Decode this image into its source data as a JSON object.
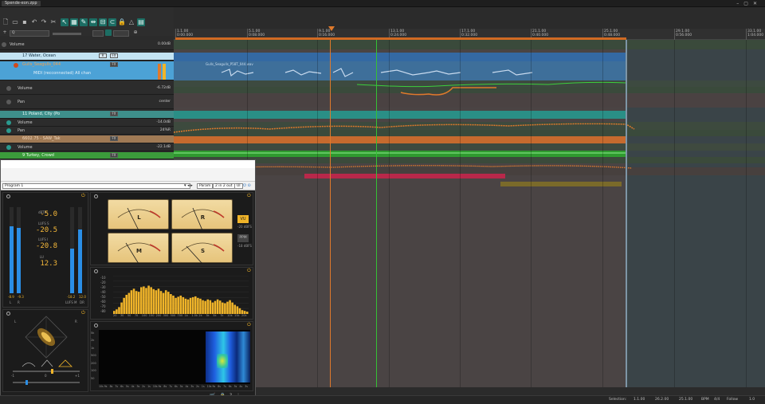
{
  "window": {
    "tab_title": "Spende-eon.zpp"
  },
  "ruler": {
    "marks": [
      {
        "bar": "1.1.00",
        "time": "0:00.000"
      },
      {
        "bar": "5.1.00",
        "time": "0:08.000"
      },
      {
        "bar": "9.1.00",
        "time": "0:16.000"
      },
      {
        "bar": "13.1.00",
        "time": "0:24.000"
      },
      {
        "bar": "17.1.00",
        "time": "0:32.000"
      },
      {
        "bar": "21.1.00",
        "time": "0:40.000"
      },
      {
        "bar": "25.1.00",
        "time": "0:48.000"
      },
      {
        "bar": "29.1.00",
        "time": "0:56.000"
      },
      {
        "bar": "33.1.00",
        "time": "1:04.000"
      }
    ]
  },
  "tracks": {
    "master_volume": {
      "label": "Volume",
      "value": "0.00dB"
    },
    "track1": {
      "name": "17 Water, Ocean",
      "mode": "FX"
    },
    "track2": {
      "name": "Gulls_Seagulls_044",
      "mode": "FX"
    },
    "midi_row": {
      "label": "MIDI (recconnected) All chan"
    },
    "auto_volume": {
      "label": "Volume",
      "value": "-6.72dB"
    },
    "auto_pan": {
      "label": "Pan",
      "value": "center"
    },
    "track3": {
      "name": "11 Poland, City (Po",
      "mode": "FX"
    },
    "t3_volume": {
      "label": "Volume",
      "value": "-14.0dB"
    },
    "t3_pan": {
      "label": "Pan",
      "value": "24%R"
    },
    "track4": {
      "name": "6602.75 - SAW_Tak",
      "mode": "FX"
    },
    "t4_volume": {
      "label": "Volume",
      "value": "-22.1dB"
    },
    "track5": {
      "name": "9 Turkey, Crowd",
      "mode": "FX"
    }
  },
  "clips": {
    "gulls_label": "Gulls_Seagulls_P58T_044.wav"
  },
  "plugin": {
    "preset": "Program 1",
    "param_label": "Param",
    "io_label": "2 in 2 out",
    "ui_label": "UI",
    "loudness": {
      "true_peak": "-5.0",
      "short_term": "-20.5",
      "integrated": "-20.8",
      "range": "12.3",
      "label_tp": "dBTP",
      "label_st": "LUFS S",
      "label_i": "LUFS I",
      "label_lra": "LU",
      "meter_left_l": "L",
      "meter_left_r": "R",
      "meter_right_l": "LUFS M",
      "meter_right_r": "DR",
      "peak_l": "-8.9",
      "peak_r": "-9.3",
      "peak_m": "-18.2",
      "peak_dr": "12.0"
    },
    "vu": {
      "meters": [
        "L",
        "R",
        "M",
        "S"
      ],
      "btn_vu": "VU",
      "btn_ppm": "PPM",
      "ref1": "-20 dBFS",
      "ref2": "-18 dBFS"
    },
    "spectrum": {
      "y_ticks": [
        "-10",
        "-20",
        "-30",
        "-40",
        "-50",
        "-60",
        "-70",
        "-80"
      ],
      "x_ticks": [
        "20",
        "30",
        "50",
        "70",
        "100",
        "150",
        "200",
        "300",
        "500",
        "700",
        "1k",
        "1.5k",
        "2k",
        "3k",
        "5k",
        "7k",
        "10k",
        "15k",
        "20k"
      ],
      "levels": [
        0.08,
        0.12,
        0.18,
        0.3,
        0.42,
        0.5,
        0.55,
        0.62,
        0.66,
        0.6,
        0.58,
        0.7,
        0.72,
        0.68,
        0.74,
        0.7,
        0.65,
        0.62,
        0.66,
        0.6,
        0.55,
        0.62,
        0.58,
        0.52,
        0.48,
        0.42,
        0.45,
        0.48,
        0.44,
        0.4,
        0.38,
        0.42,
        0.44,
        0.46,
        0.42,
        0.4,
        0.36,
        0.34,
        0.38,
        0.36,
        0.3,
        0.34,
        0.38,
        0.35,
        0.3,
        0.28,
        0.32,
        0.36,
        0.3,
        0.24,
        0.2,
        0.15,
        0.1,
        0.08,
        0.06
      ]
    },
    "spectrogram": {
      "y_ticks": [
        "5k",
        "2k",
        "1k",
        "500",
        "200",
        "100",
        "50"
      ],
      "x_ticks": [
        "10s",
        "9s",
        "8s",
        "7s",
        "6s",
        "5s",
        "4s",
        "3s",
        "2s",
        "1s",
        "10s",
        "9s",
        "8s",
        "7s",
        "6s",
        "5s",
        "4s",
        "3s",
        "2s",
        "1s",
        "10s",
        "9s",
        "8s",
        "7s",
        "6s",
        "5s",
        "4s",
        "3s"
      ]
    },
    "goniometer": {
      "label_l": "L",
      "label_r": "R",
      "scale_l": "-1",
      "scale_mid": "0",
      "scale_r": "+1"
    }
  },
  "status": {
    "selection_label": "Selection:",
    "sel_start": "1.1.00",
    "sel_end": "26.2.00",
    "sel_len": "25.1.00",
    "bpm_label": "BPM",
    "bpm_mode": "120",
    "signature": "4/4",
    "follow": "Follow",
    "zoom": "1.0"
  },
  "colors": {
    "accent_orange": "#e07a2b",
    "teal": "#1c6d63",
    "blue_clip": "#3b6ea5",
    "green_clip": "#2f9a2f",
    "amber": "#f0b429"
  }
}
